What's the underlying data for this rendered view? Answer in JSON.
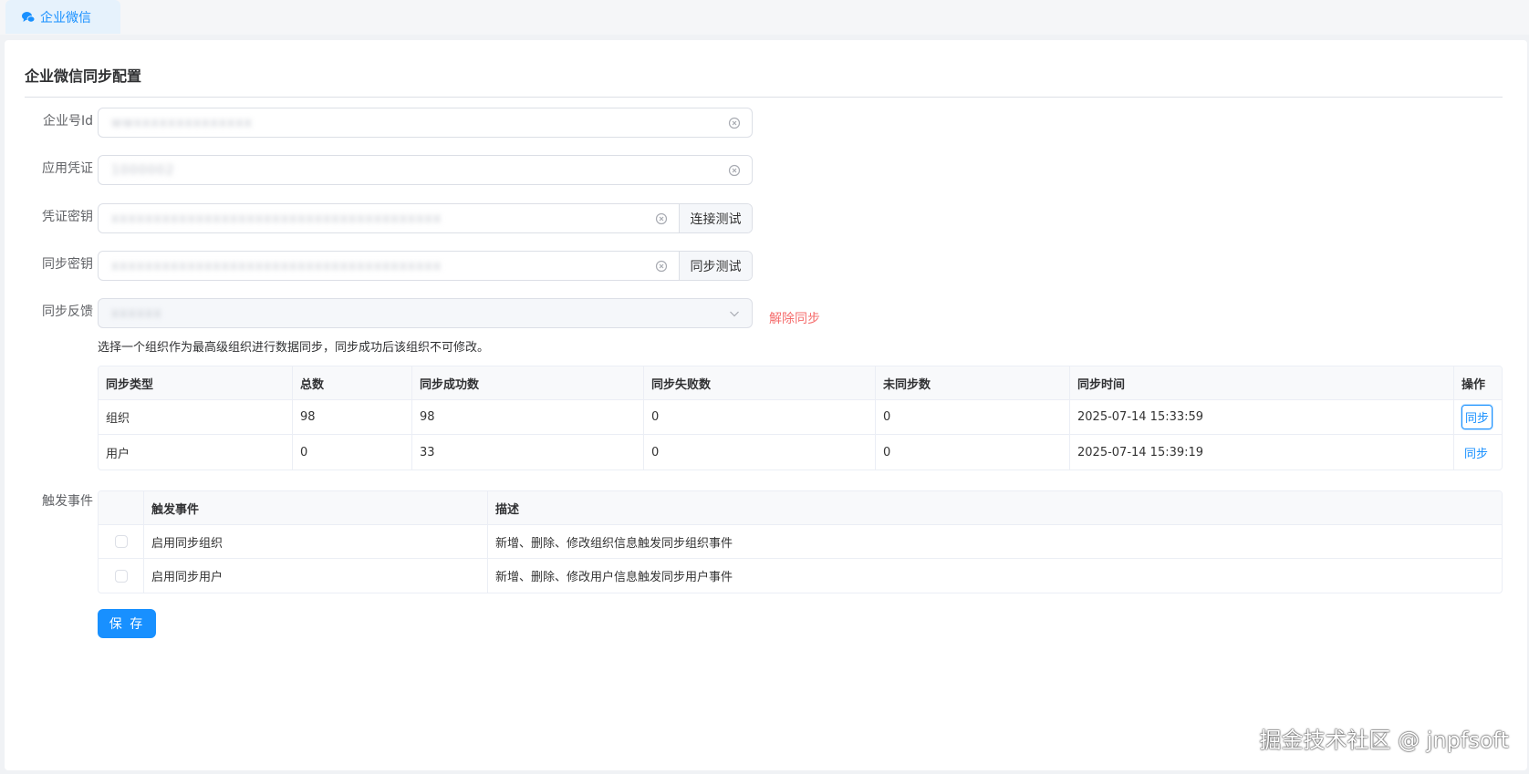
{
  "tab": {
    "label": "企业微信",
    "icon": "chat-bubbles-icon"
  },
  "page": {
    "title": "企业微信同步配置"
  },
  "form": {
    "corp_id": {
      "label": "企业号Id",
      "value": "wwxxxxxxxxxxxxxx"
    },
    "agent_id": {
      "label": "应用凭证",
      "value": "1000002"
    },
    "secret": {
      "label": "凭证密钥",
      "value": "xxxxxxxxxxxxxxxxxxxxxxxxxxxxxxxxxxxxxxx",
      "action": "连接测试"
    },
    "sync_secret": {
      "label": "同步密钥",
      "value": "xxxxxxxxxxxxxxxxxxxxxxxxxxxxxxxxxxxxxxx",
      "action": "同步测试"
    },
    "feedback": {
      "label": "同步反馈",
      "value": "xxxxxx",
      "unsync": "解除同步"
    },
    "hint": "选择一个组织作为最高级组织进行数据同步，同步成功后该组织不可修改。"
  },
  "sync_table": {
    "columns": [
      "同步类型",
      "总数",
      "同步成功数",
      "同步失败数",
      "未同步数",
      "同步时间",
      "操作"
    ],
    "rows": [
      {
        "type": "组织",
        "total": "98",
        "success": "98",
        "failed": "0",
        "pending": "0",
        "time": "2025-07-14 15:33:59",
        "action": "同步"
      },
      {
        "type": "用户",
        "total": "0",
        "success": "33",
        "failed": "0",
        "pending": "0",
        "time": "2025-07-14 15:39:19",
        "action": "同步"
      }
    ]
  },
  "events": {
    "label": "触发事件",
    "columns": [
      "",
      "触发事件",
      "描述"
    ],
    "rows": [
      {
        "name": "启用同步组织",
        "desc": "新增、删除、修改组织信息触发同步组织事件",
        "checked": false
      },
      {
        "name": "启用同步用户",
        "desc": "新增、删除、修改用户信息触发同步用户事件",
        "checked": false
      }
    ]
  },
  "save_label": "保 存",
  "watermark": "掘金技术社区 @ jnpfsoft",
  "colors": {
    "primary": "#1890ff",
    "danger": "#f56c6c",
    "border": "#dcdfe6"
  }
}
